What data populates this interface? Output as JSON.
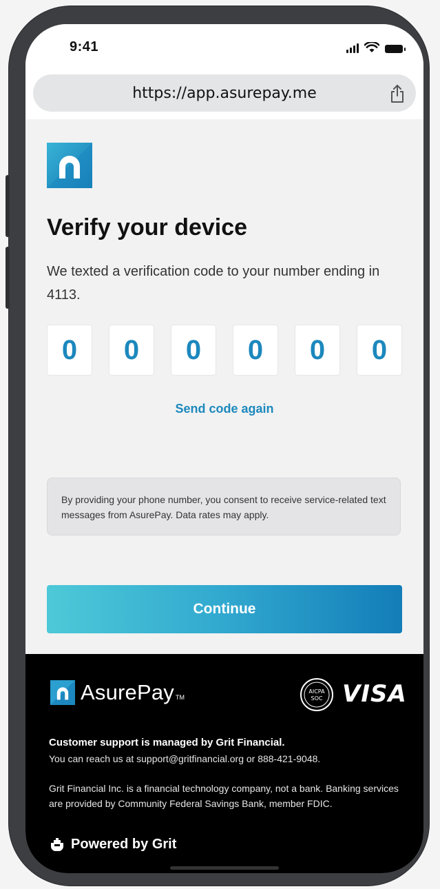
{
  "status_bar": {
    "time": "9:41"
  },
  "browser": {
    "url": "https://app.asurepay.me"
  },
  "page": {
    "title": "Verify your device",
    "subtitle": "We texted a verification code to your number ending in 4113.",
    "code_digits": [
      "0",
      "0",
      "0",
      "0",
      "0",
      "0"
    ],
    "resend_label": "Send code again",
    "consent_notice": "By providing your phone number, you consent to receive service-related text messages from AsurePay. Data rates may apply.",
    "continue_label": "Continue"
  },
  "footer": {
    "brand_name": "AsurePay",
    "brand_tm": "TM",
    "aicpa_label": "AICPA",
    "soc_label": "SOC",
    "visa_label": "VISA",
    "support_title": "Customer support is managed by Grit Financial.",
    "support_text": "You can reach us at support@gritfinancial.org or 888-421-9048.",
    "disclaimer": "Grit Financial Inc. is a financial technology company, not a bank. Banking services are provided by Community Federal Savings Bank, member FDIC.",
    "powered_by": "Powered by Grit"
  },
  "colors": {
    "accent": "#1c88bd",
    "button_gradient_start": "#4dc9d8",
    "button_gradient_end": "#137db8",
    "footer_bg": "#000000"
  },
  "icons": [
    "signal-icon",
    "wifi-icon",
    "battery-icon",
    "share-icon",
    "asurepay-logo-icon",
    "aicpa-soc-icon",
    "grit-hand-icon"
  ]
}
